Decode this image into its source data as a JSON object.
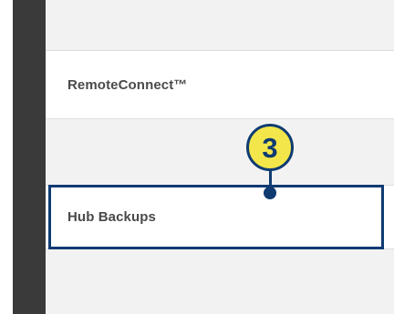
{
  "menu": {
    "items": [
      {
        "label": "RemoteConnect™"
      },
      {
        "label": "Hub Backups"
      }
    ]
  },
  "callout": {
    "number": "3",
    "target": "Hub Backups",
    "color": "#0f3b72",
    "badge_color": "#f3e64a"
  }
}
